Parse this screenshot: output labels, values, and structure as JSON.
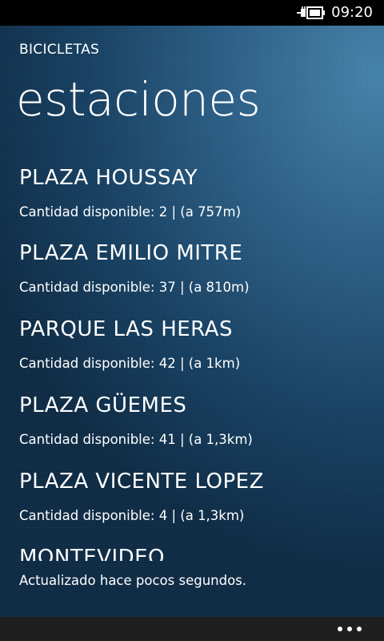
{
  "status_bar": {
    "time": "09:20",
    "battery_icon": "battery-charging-icon"
  },
  "header": {
    "app_title": "BICICLETAS",
    "page_title": "estaciones"
  },
  "stations": [
    {
      "name": "PLAZA HOUSSAY",
      "info": "Cantidad disponible: 2 | (a 757m)"
    },
    {
      "name": "PLAZA EMILIO MITRE",
      "info": "Cantidad disponible: 37 | (a 810m)"
    },
    {
      "name": "PARQUE LAS HERAS",
      "info": "Cantidad disponible: 42 | (a 1km)"
    },
    {
      "name": "PLAZA GÜEMES",
      "info": "Cantidad disponible: 41 | (a 1,3km)"
    },
    {
      "name": "PLAZA VICENTE LOPEZ",
      "info": "Cantidad disponible: 4 | (a 1,3km)"
    },
    {
      "name": "MONTEVIDEO",
      "info": ""
    }
  ],
  "footer": {
    "update_status": "Actualizado hace pocos segundos."
  },
  "app_bar": {
    "more_icon": "more-ellipsis-icon"
  },
  "colors": {
    "status_bar_bg": "#000000",
    "background_accent": "#2f6a98",
    "app_bar_bg": "#1f1f1f",
    "text": "#ffffff"
  }
}
